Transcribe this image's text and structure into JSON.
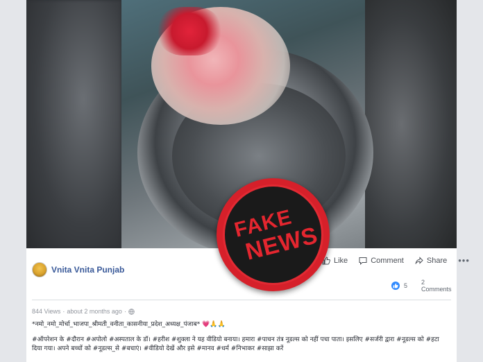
{
  "post": {
    "author": "Vnita Vnita Punjab",
    "views": "844 Views",
    "time_ago": "about 2 months ago",
    "line1": "*नमो_नमो_मोर्चा_भाजपा_श्रीमती_वनीता_कासनीया_प्रदेश_अध्यक्ष_पंजाब*",
    "line1_emoji": "💗🙏🙏",
    "line2": "#ऑपरेशन के #दौरान #अपोलो #अस्पताल के डॉ। #हरीश #शुक्ला ने यह वीडियो बनाया। हमारा #पाचन तंत्र नूडल्स को नहीं पचा पाता। इसलिए #सर्जरी द्वारा #नूडल्स को #हटा दिया गया। अपने बच्चों को #नूडल्स_से #बचाएं। #वीडियो देखें और इसे #मानव #धर्म #निभाकर #साझा करें"
  },
  "actions": {
    "like": "Like",
    "comment": "Comment",
    "share": "Share",
    "more": "•••"
  },
  "counts": {
    "likes": "5",
    "comments": "2 Comments"
  },
  "stamp": {
    "line1": "FAKE",
    "line2": "NEWS"
  },
  "colors": {
    "author_link": "#385898",
    "like_blue": "#2e89ff",
    "stamp_red": "#d6202a"
  },
  "icons": [
    "like-icon",
    "comment-icon",
    "share-icon",
    "globe-icon",
    "more-icon"
  ]
}
